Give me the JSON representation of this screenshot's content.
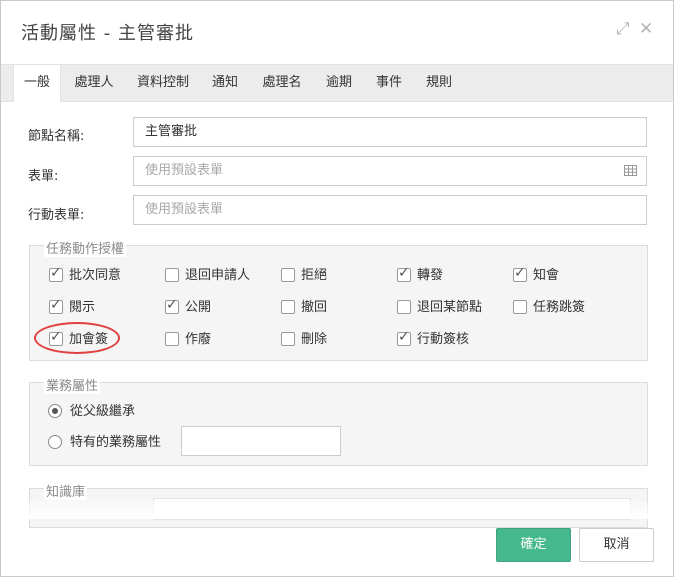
{
  "dialog": {
    "title": "活動屬性 - 主管審批",
    "expand_icon": "expand-icon",
    "close_icon": "close-icon"
  },
  "tabs": [
    {
      "label": "一般",
      "active": true
    },
    {
      "label": "處理人"
    },
    {
      "label": "資料控制"
    },
    {
      "label": "通知"
    },
    {
      "label": "處理名"
    },
    {
      "label": "逾期"
    },
    {
      "label": "事件"
    },
    {
      "label": "規則"
    }
  ],
  "fields": {
    "node_name_label": "節點名稱:",
    "node_name_value": "主管審批",
    "form_label": "表單:",
    "form_placeholder": "使用預設表單",
    "mobile_form_label": "行動表單:",
    "mobile_form_placeholder": "使用預設表單"
  },
  "task_actions": {
    "legend": "任務動作授權",
    "items": [
      {
        "label": "批次同意",
        "checked": true
      },
      {
        "label": "退回申請人",
        "checked": false
      },
      {
        "label": "拒絕",
        "checked": false
      },
      {
        "label": "轉發",
        "checked": true
      },
      {
        "label": "知會",
        "checked": true
      },
      {
        "label": "閱示",
        "checked": true
      },
      {
        "label": "公開",
        "checked": true
      },
      {
        "label": "撤回",
        "checked": false
      },
      {
        "label": "退回某節點",
        "checked": false
      },
      {
        "label": "任務跳簽",
        "checked": false
      },
      {
        "label": "加會簽",
        "checked": true
      },
      {
        "label": "作廢",
        "checked": false
      },
      {
        "label": "刪除",
        "checked": false
      },
      {
        "label": "行動簽核",
        "checked": true
      }
    ]
  },
  "business_attr": {
    "legend": "業務屬性",
    "inherit_label": "從父級繼承",
    "specific_label": "特有的業務屬性",
    "selected": "inherit"
  },
  "knowledge": {
    "legend": "知識庫"
  },
  "buttons": {
    "confirm": "確定",
    "cancel": "取消"
  },
  "colors": {
    "primary": "#46b88e",
    "annotation": "#e04040"
  }
}
